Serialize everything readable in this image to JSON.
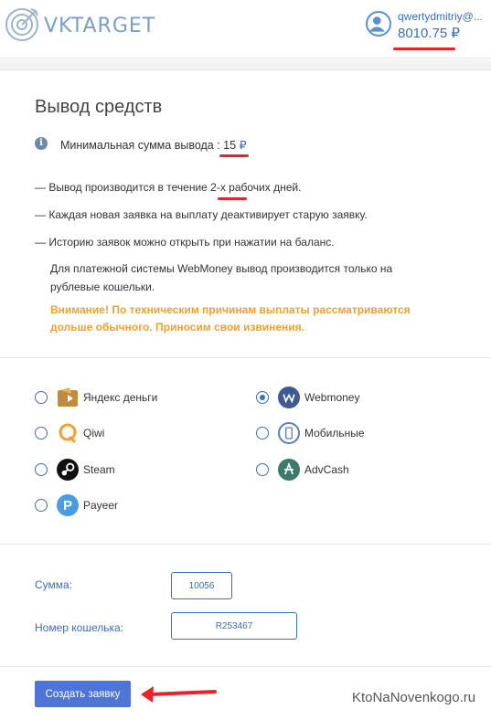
{
  "header": {
    "logo_text": "VKTARGET",
    "username": "qwertydmitriy@...",
    "balance": "8010.75",
    "currency": "₽"
  },
  "page": {
    "title": "Вывод средств",
    "min_label": "Минимальная сумма вывода : ",
    "min_value": "15",
    "rules": [
      "— Вывод производится в течение 2-х рабочих дней.",
      "— Каждая новая заявка на выплату деактивирует старую заявку.",
      "— Историю заявок можно открыть при нажатии на баланс."
    ],
    "webmoney_note": "Для платежной системы WebMoney вывод производится только на рублевые кошельки.",
    "warning": "Внимание! По техническим причинам выплаты рассматриваются дольше обычного. Приносим свои извинения."
  },
  "payment_methods": [
    {
      "label": "Яндекс деньги",
      "checked": false,
      "icon": "yandex-money-icon"
    },
    {
      "label": "Webmoney",
      "checked": true,
      "icon": "webmoney-icon"
    },
    {
      "label": "Qiwi",
      "checked": false,
      "icon": "qiwi-icon"
    },
    {
      "label": "Мобильные",
      "checked": false,
      "icon": "mobile-phone-icon"
    },
    {
      "label": "Steam",
      "checked": false,
      "icon": "steam-icon"
    },
    {
      "label": "AdvCash",
      "checked": false,
      "icon": "advcash-icon"
    },
    {
      "label": "Payeer",
      "checked": false,
      "icon": "payeer-icon"
    }
  ],
  "form": {
    "amount_label": "Сумма:",
    "amount_value": "10056",
    "wallet_label": "Номер кошелька:",
    "wallet_value": "R253467",
    "submit_label": "Создать заявку"
  },
  "watermark": "KtoNaNovenkogo.ru",
  "colors": {
    "accent": "#3b6fb5",
    "button": "#4d74d6",
    "warning": "#f0a030",
    "highlight": "#e8242a"
  }
}
